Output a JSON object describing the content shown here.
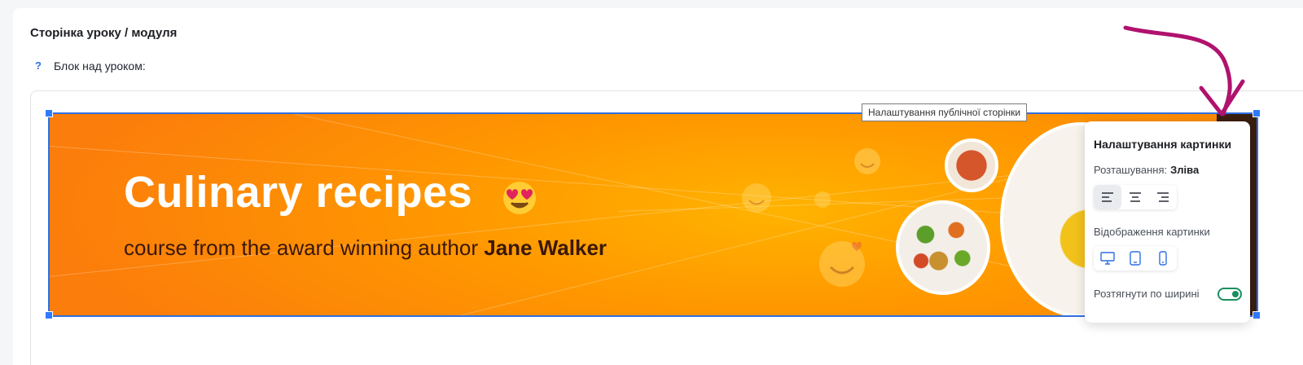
{
  "page": {
    "section_title": "Сторінка уроку / модуля",
    "help_icon": "?",
    "block_label": "Блок над уроком:"
  },
  "banner": {
    "title": "Culinary recipes",
    "subtitle_prefix": "course from the award winning author",
    "subtitle_author": "Jane Walker",
    "colors": {
      "primary": "#ff9800",
      "title_text": "#ffffff",
      "subtitle_text": "#3a1708"
    }
  },
  "tooltip": {
    "text": "Налаштування публічної сторінки"
  },
  "settings_panel": {
    "title": "Налаштування картинки",
    "position_label": "Розташування:",
    "position_value": "Зліва",
    "align_options": [
      "align-left-icon",
      "align-center-icon",
      "align-right-icon"
    ],
    "align_selected": 0,
    "display_label": "Відображення картинки",
    "display_options": [
      "desktop-icon",
      "tablet-icon",
      "mobile-icon"
    ],
    "stretch_label": "Розтягнути по ширині",
    "stretch_enabled": true,
    "accent_color": "#2f6fe0",
    "toggle_color": "#1a8f5e"
  }
}
